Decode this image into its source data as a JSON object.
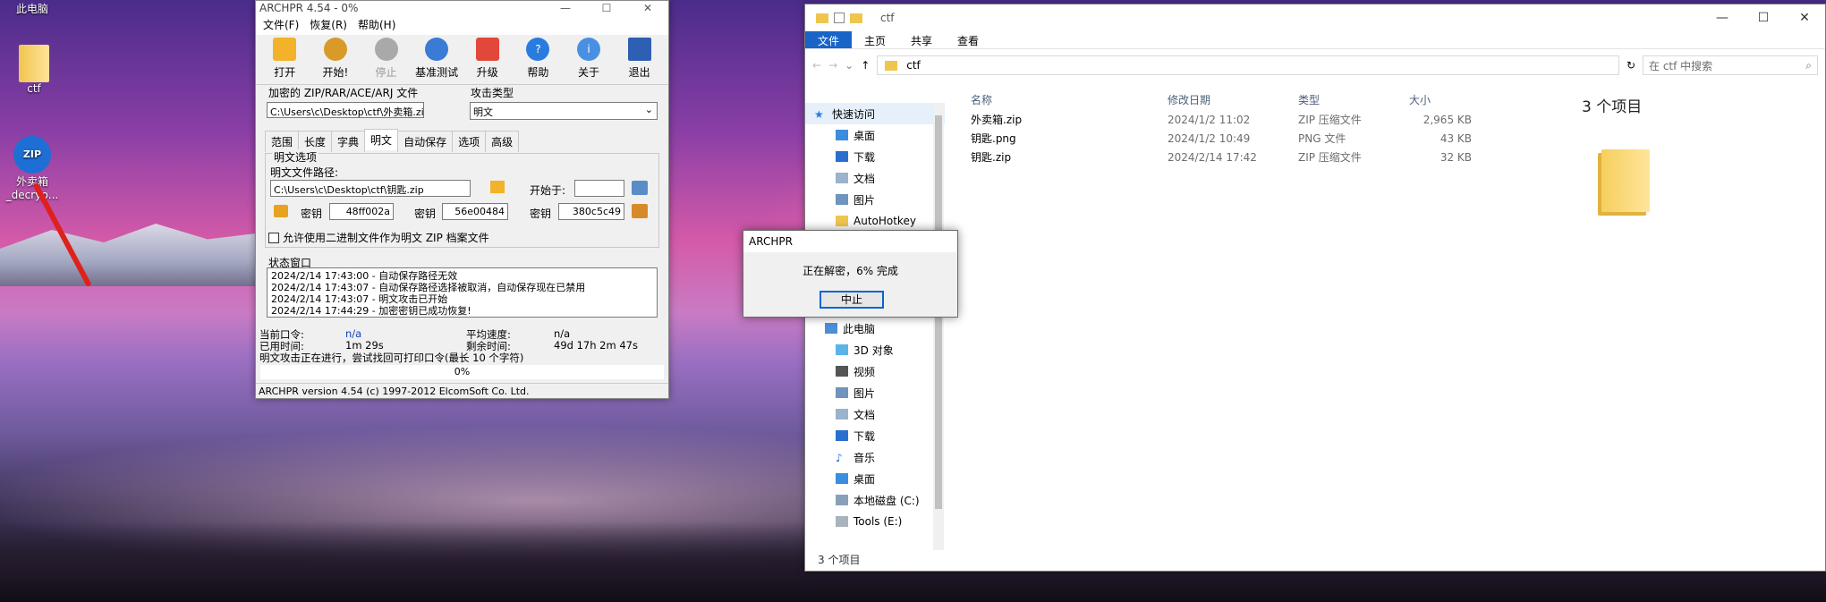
{
  "desktop": {
    "icons": [
      {
        "label": "此电脑"
      },
      {
        "label": "ctf"
      },
      {
        "label": "外卖箱_decryp..."
      }
    ]
  },
  "archpr": {
    "title": "ARCHPR 4.54 - 0%",
    "menu": [
      "文件(F)",
      "恢复(R)",
      "帮助(H)"
    ],
    "toolbar": [
      "打开",
      "开始!",
      "停止",
      "基准测试",
      "升级",
      "帮助",
      "关于",
      "退出"
    ],
    "enc_file_label": "加密的 ZIP/RAR/ACE/ARJ 文件",
    "enc_file_value": "C:\\Users\\c\\Desktop\\ctf\\外卖箱.zip",
    "attack_label": "攻击类型",
    "attack_value": "明文",
    "tabs": [
      "范围",
      "长度",
      "字典",
      "明文",
      "自动保存",
      "选项",
      "高级"
    ],
    "plain_opts_label": "明文选项",
    "plain_path_label": "明文文件路径:",
    "plain_path_value": "C:\\Users\\c\\Desktop\\ctf\\钥匙.zip",
    "start_label": "开始于:",
    "key_label": "密钥",
    "keys": [
      "48ff002a",
      "56e00484",
      "380c5c49"
    ],
    "allow_binary": "允许使用二进制文件作为明文 ZIP 档案文件",
    "status_window": "状态窗口",
    "log": [
      "2024/2/14 17:43:00 - 自动保存路径无效",
      "2024/2/14 17:43:07 - 自动保存路径选择被取消，自动保存现在已禁用",
      "2024/2/14 17:43:07 - 明文攻击已开始",
      "2024/2/14 17:44:29 - 加密密钥已成功恢复!"
    ],
    "cur_pw_label": "当前口令:",
    "cur_pw": "n/a",
    "avg_speed_label": "平均速度:",
    "avg_speed": "n/a",
    "elapsed_label": "已用时间:",
    "elapsed": "1m 29s",
    "remain_label": "剩余时间:",
    "remain": "49d 17h 2m 47s",
    "note": "明文攻击正在进行，尝试找回可打印口令(最长 10 个字符)",
    "progress": "0%",
    "statusbar": "ARCHPR version 4.54 (c) 1997-2012 ElcomSoft Co. Ltd."
  },
  "explorer": {
    "title": "ctf",
    "ribbon": [
      "文件",
      "主页",
      "共享",
      "查看"
    ],
    "path": "ctf",
    "search_placeholder": "在 ctf 中搜索",
    "nav": [
      "快速访问",
      "桌面",
      "下载",
      "文档",
      "图片",
      "AutoHotkey",
      "此电脑",
      "3D 对象",
      "视频",
      "图片",
      "文档",
      "下载",
      "音乐",
      "桌面",
      "本地磁盘 (C:)",
      "Tools (E:)"
    ],
    "columns": [
      "名称",
      "修改日期",
      "类型",
      "大小"
    ],
    "files": [
      {
        "name": "外卖箱.zip",
        "date": "2024/1/2 11:02",
        "type": "ZIP 压缩文件",
        "size": "2,965 KB"
      },
      {
        "name": "钥匙.png",
        "date": "2024/1/2 10:49",
        "type": "PNG 文件",
        "size": "43 KB"
      },
      {
        "name": "钥匙.zip",
        "date": "2024/2/14 17:42",
        "type": "ZIP 压缩文件",
        "size": "32 KB"
      }
    ],
    "preview": "3 个项目",
    "status": "3 个项目"
  },
  "dialog": {
    "title": "ARCHPR",
    "message": "正在解密，6% 完成",
    "button": "中止"
  }
}
